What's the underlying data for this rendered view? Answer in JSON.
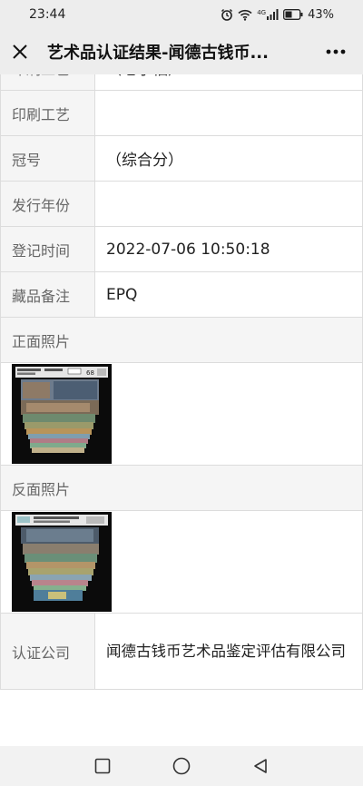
{
  "status": {
    "time": "23:44",
    "battery": "43%",
    "network": "4G"
  },
  "header": {
    "title": "艺术品认证结果-闻德古钱币..."
  },
  "rows": [
    {
      "label": "印刷工艺",
      "value": "（七小福）"
    },
    {
      "label": "印刷工艺",
      "value": ""
    },
    {
      "label": "冠号",
      "value": "（综合分）"
    },
    {
      "label": "发行年份",
      "value": ""
    },
    {
      "label": "登记时间",
      "value": "2022-07-06 10:50:18"
    },
    {
      "label": "藏品备注",
      "value": "EPQ"
    }
  ],
  "front_photo": {
    "label": "正面照片",
    "grade": "68",
    "grade_label": "EPQ"
  },
  "back_photo": {
    "label": "反面照片"
  },
  "company": {
    "label": "认证公司",
    "value": "闻德古钱币艺术品鉴定评估有限公司"
  }
}
